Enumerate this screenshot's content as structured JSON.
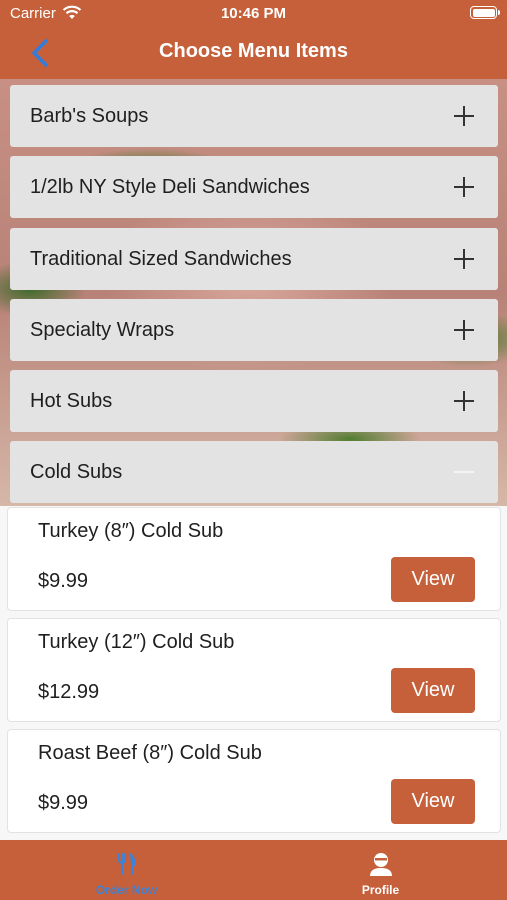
{
  "status_bar": {
    "carrier": "Carrier",
    "time": "10:46 PM"
  },
  "nav": {
    "title": "Choose Menu Items",
    "back_icon": "chevron-left-icon"
  },
  "colors": {
    "accent": "#c5603a",
    "active_tab": "#3b83d9",
    "category_bg": "#e3e3e3"
  },
  "categories": [
    {
      "label": "Barb's Soups",
      "expanded": false
    },
    {
      "label": "1/2lb NY Style Deli Sandwiches",
      "expanded": false
    },
    {
      "label": "Traditional Sized Sandwiches",
      "expanded": false
    },
    {
      "label": "Specialty Wraps",
      "expanded": false
    },
    {
      "label": "Hot Subs",
      "expanded": false
    },
    {
      "label": "Cold Subs",
      "expanded": true
    }
  ],
  "items": [
    {
      "name": "Turkey (8″) Cold Sub",
      "price": "$9.99",
      "button": "View"
    },
    {
      "name": "Turkey (12″) Cold Sub",
      "price": "$12.99",
      "button": "View"
    },
    {
      "name": "Roast Beef (8″) Cold Sub",
      "price": "$9.99",
      "button": "View"
    }
  ],
  "tabs": [
    {
      "label": "Order Now",
      "icon": "utensils-icon",
      "active": true
    },
    {
      "label": "Profile",
      "icon": "person-icon",
      "active": false
    }
  ]
}
